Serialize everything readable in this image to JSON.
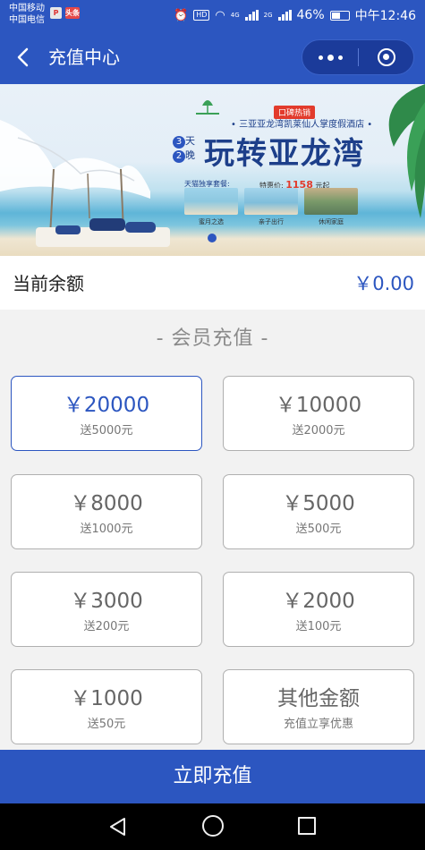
{
  "status_bar": {
    "carrier_1": "中国移动",
    "carrier_2": "中国电信",
    "app_badge_1": "P",
    "app_badge_2": "头条",
    "battery": "46%",
    "time": "中午12:46",
    "network_1": "4G",
    "network_2": "2G",
    "hd": "HD"
  },
  "header": {
    "title": "充值中心"
  },
  "banner": {
    "badge": "口碑热销",
    "hotel": "• 三亚亚龙湾凯莱仙人掌度假酒店 •",
    "days_number": "3",
    "days_unit": "天",
    "nights_number": "2",
    "nights_unit": "晚",
    "slogan": "玩转亚龙湾",
    "package_label": "天猫独享套餐:",
    "price_prefix": "特惠价:",
    "price": "1158",
    "price_suffix": "元起",
    "photos": [
      {
        "caption": "蜜月之选"
      },
      {
        "caption": "亲子出行"
      },
      {
        "caption": "休闲家庭"
      }
    ]
  },
  "balance": {
    "label": "当前余额",
    "value": "￥0.00"
  },
  "section_title": "-  会员充值  -",
  "options": [
    {
      "amount": "￥20000",
      "bonus": "送5000元",
      "selected": true
    },
    {
      "amount": "￥10000",
      "bonus": "送2000元",
      "selected": false
    },
    {
      "amount": "￥8000",
      "bonus": "送1000元",
      "selected": false
    },
    {
      "amount": "￥5000",
      "bonus": "送500元",
      "selected": false
    },
    {
      "amount": "￥3000",
      "bonus": "送200元",
      "selected": false
    },
    {
      "amount": "￥2000",
      "bonus": "送100元",
      "selected": false
    },
    {
      "amount": "￥1000",
      "bonus": "送50元",
      "selected": false
    },
    {
      "amount": "其他金额",
      "bonus": "充值立享优惠",
      "selected": false
    }
  ],
  "pay_button": "立即充值",
  "colors": {
    "primary": "#2c56c0",
    "text_muted": "#777777"
  },
  "icons": {
    "back": "back-arrow-icon",
    "more": "more-dots-icon",
    "close": "close-miniprogram-icon",
    "nav_back": "nav-back-icon",
    "nav_home": "nav-home-icon",
    "nav_recent": "nav-recent-icon"
  }
}
